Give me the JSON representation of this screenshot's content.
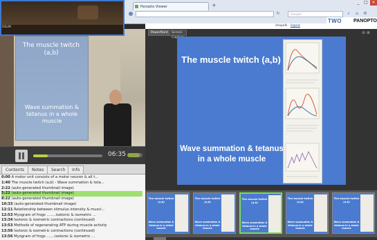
{
  "browser": {
    "tab_title": "Panopto Viewer",
    "new_tab": "+",
    "url": "",
    "search_placeholder": "Google",
    "window_buttons": [
      "_",
      "□",
      "×"
    ]
  },
  "app": {
    "logo_brand": "TWO",
    "logo_name": "PANOPTO",
    "user": "shopalk",
    "logout": "logout"
  },
  "dark_window": {
    "label": "DSLM"
  },
  "webcam": {
    "screen_title": "The muscle twitch (a,b)",
    "screen_subtitle": "Wave summation & tetanus in a whole muscle"
  },
  "player": {
    "time": "06:35",
    "progress_fraction": 0.21,
    "volume_fraction": 0.8
  },
  "left_tabs": [
    "Contents",
    "Notes",
    "Search",
    "Info"
  ],
  "left_tab_active": 0,
  "outline": [
    {
      "time": "0:00",
      "text": "A motor unit consists of a motor neuron & all t..."
    },
    {
      "time": "1:40",
      "text": "The muscle twitch (a,b) - Wave summation & teta..."
    },
    {
      "time": "2:22",
      "text": "(auto-generated thumbnail image)"
    },
    {
      "time": "5:22",
      "text": "(auto-generated thumbnail image)",
      "active": true
    },
    {
      "time": "8:22",
      "text": "(auto-generated thumbnail image)"
    },
    {
      "time": "10:33",
      "text": "(auto-generated thumbnail image)"
    },
    {
      "time": "12:11",
      "text": "Relationship between stimulus intensity & muscl..."
    },
    {
      "time": "12:53",
      "text": "Myogram of frogs ........isotonic & isometric ..."
    },
    {
      "time": "13:34",
      "text": "Isotonic & isometric contractions (continued)"
    },
    {
      "time": "13:53",
      "text": "Methods of regenerating ATP during muscle activity"
    },
    {
      "time": "13:56",
      "text": "Isotonic & isometric contractions (continued)"
    },
    {
      "time": "13:56",
      "text": "Myogram of frogs .......isotonic & isometric ..."
    }
  ],
  "primary_tabs": [
    "PowerPoint",
    "Screen Capture"
  ],
  "primary_tab_active": 0,
  "zoom_icons": "⊖ ⊕",
  "slide": {
    "title": "The muscle twitch (a,b)",
    "subtitle": "Wave summation & tetanus in a whole muscle"
  },
  "thumbnails": [
    {
      "title": "The muscle twitch (a,b)",
      "subtitle": "Wave summation & tetanus in a whole muscle"
    },
    {
      "title": "The muscle twitch (a,b)",
      "subtitle": "Wave summation & tetanus in a whole muscle"
    },
    {
      "title": "The muscle twitch (a,b)",
      "subtitle": "Wave summation & tetanus in a whole muscle",
      "selected": true
    },
    {
      "title": "The muscle twitch (a,b)",
      "subtitle": "Wave summation & tetanus in a whole muscle"
    },
    {
      "title": "The muscle twitch (a,b)",
      "subtitle": "Wave summation & tetanus in a whole muscle"
    }
  ],
  "colors": {
    "slide_background": "#4a7bd0",
    "active_row": "#9ee06f",
    "selected_thumb_border": "#7ed957",
    "progress_fill": "#b8d04c"
  }
}
